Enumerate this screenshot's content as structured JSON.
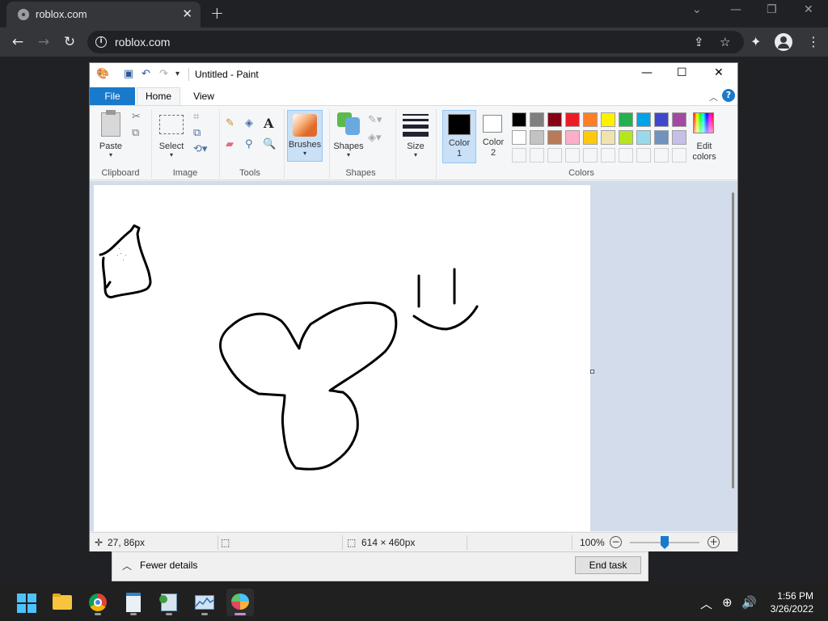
{
  "browser": {
    "tab_title": "roblox.com",
    "url": "roblox.com"
  },
  "paint": {
    "window_title": "Untitled - Paint",
    "tabs": {
      "file": "File",
      "home": "Home",
      "view": "View"
    },
    "ribbon": {
      "paste": "Paste",
      "clipboard": "Clipboard",
      "select": "Select",
      "image": "Image",
      "tools": "Tools",
      "brushes": "Brushes",
      "shapes_btn": "Shapes",
      "shapes": "Shapes",
      "size": "Size",
      "color1": "Color\n1",
      "color1_a": "Color",
      "color1_b": "1",
      "color2_a": "Color",
      "color2_b": "2",
      "edit_colors_a": "Edit",
      "edit_colors_b": "colors",
      "colors": "Colors"
    },
    "palette": {
      "row1": [
        "#000000",
        "#7f7f7f",
        "#880015",
        "#ed1c24",
        "#ff7f27",
        "#fff200",
        "#22b14c",
        "#00a2e8",
        "#3f48cc",
        "#a349a4"
      ],
      "row2": [
        "#ffffff",
        "#c3c3c3",
        "#b97a57",
        "#ffaec9",
        "#ffc90e",
        "#efe4b0",
        "#b5e61d",
        "#99d9ea",
        "#7092be",
        "#c8bfe7"
      ]
    },
    "color1_value": "#000000",
    "color2_value": "#ffffff",
    "status": {
      "cursor_pos": "27, 86px",
      "canvas_size": "614 × 460px",
      "zoom": "100%"
    }
  },
  "taskmgr": {
    "fewer_details": "Fewer details",
    "end_task": "End task"
  },
  "taskbar": {
    "time": "1:56 PM",
    "date": "3/26/2022"
  }
}
